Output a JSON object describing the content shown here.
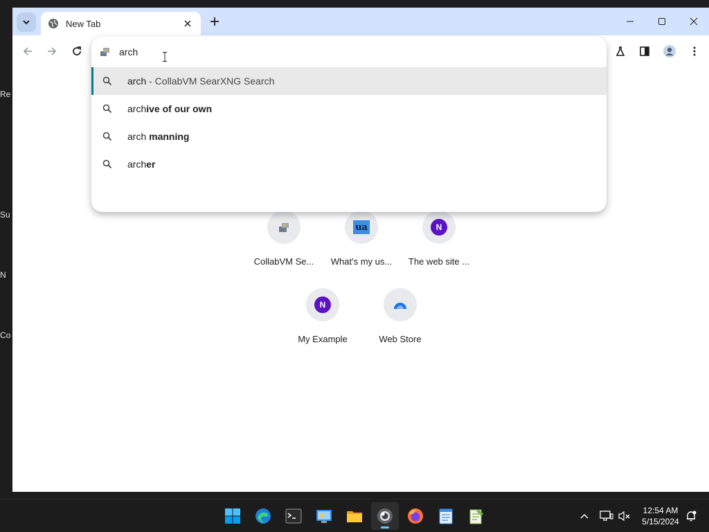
{
  "desktop": {
    "labels": [
      "Re",
      "Su",
      "N",
      "Co"
    ]
  },
  "browser": {
    "tab": {
      "title": "New Tab"
    },
    "omnibox": {
      "value": "arch",
      "suggestions": [
        {
          "prefix": "arch",
          "bold": "",
          "description": " - CollabVM SearXNG Search",
          "selected": true
        },
        {
          "prefix": "arch",
          "bold": "ive of our own",
          "description": "",
          "selected": false
        },
        {
          "prefix": "arch ",
          "bold": "manning",
          "description": "",
          "selected": false
        },
        {
          "prefix": "arch",
          "bold": "er",
          "description": "",
          "selected": false
        }
      ]
    },
    "shortcuts": [
      {
        "label": "CollabVM Se...",
        "icon": "collabvm-icon"
      },
      {
        "label": "What's my us...",
        "icon": "ua-icon",
        "glyph": "ua"
      },
      {
        "label": "The web site ...",
        "icon": "n-icon",
        "glyph": "N"
      },
      {
        "label": "My Example",
        "icon": "n-icon",
        "glyph": "N"
      },
      {
        "label": "Web Store",
        "icon": "web-store-icon"
      }
    ]
  },
  "taskbar": {
    "apps": [
      "start",
      "edge",
      "terminal",
      "control-panel",
      "file-explorer",
      "chrome",
      "firefox",
      "notepad",
      "notepad-plus-plus"
    ],
    "active_app": "chrome",
    "clock": {
      "time": "12:54 AM",
      "date": "5/15/2024"
    }
  },
  "colors": {
    "tabstrip": "#d3e3fd",
    "selection_bar": "#0b7a8a",
    "n_icon": "#5b12c4",
    "taskbar": "#1c1c1c",
    "active_indicator": "#60cdff"
  }
}
